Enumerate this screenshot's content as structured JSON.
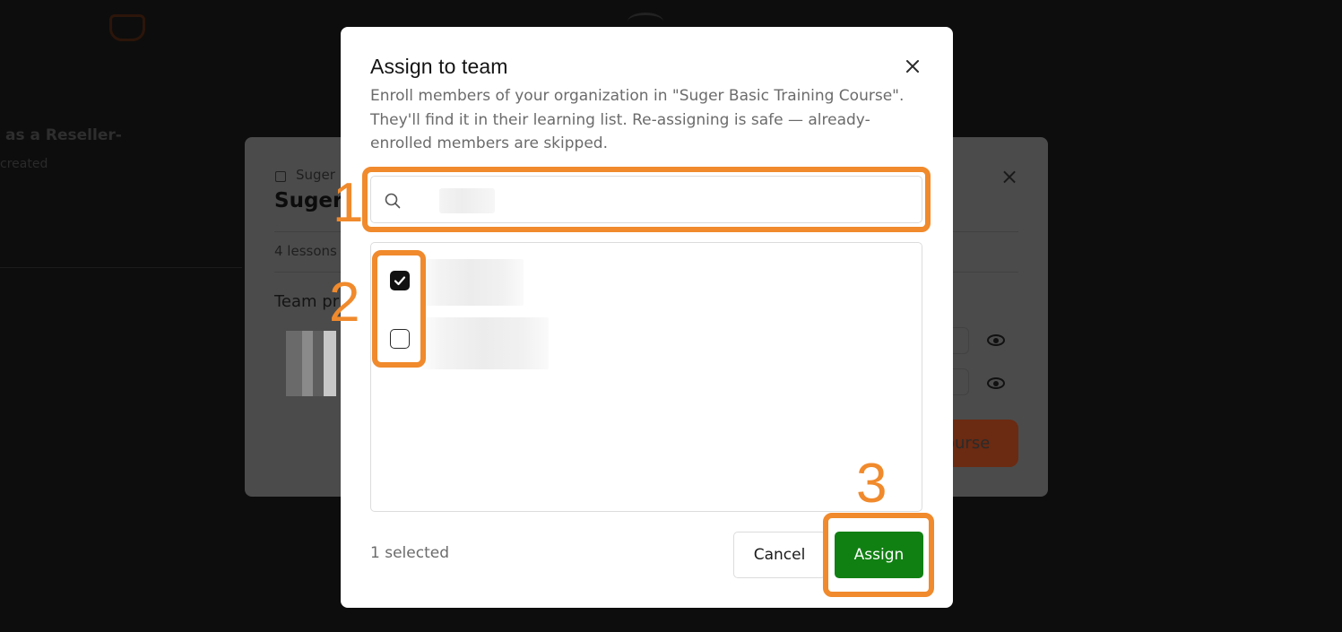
{
  "background": {
    "reseller_text": "as a Reseller-",
    "created_text": "created",
    "panel": {
      "breadcrumb": "Suger",
      "title": "Suger I",
      "lessons": "4 lessons",
      "team_heading": "Team pr",
      "cta_label": "ourse"
    }
  },
  "modal": {
    "title": "Assign to team",
    "description": "Enroll members of your organization in \"Suger Basic Training Course\". They'll find it in their learning list. Re-assigning is safe — already-enrolled members are skipped.",
    "search": {
      "value": "",
      "placeholder": ""
    },
    "members": [
      {
        "checked": true
      },
      {
        "checked": false
      }
    ],
    "selected_count": "1 selected",
    "cancel_label": "Cancel",
    "assign_label": "Assign",
    "close_icon": "close-icon",
    "search_icon": "search-icon",
    "assign_color": "#118013"
  },
  "annotations": {
    "step1": "1",
    "step2": "2",
    "step3": "3",
    "color": "#f08a2c"
  }
}
